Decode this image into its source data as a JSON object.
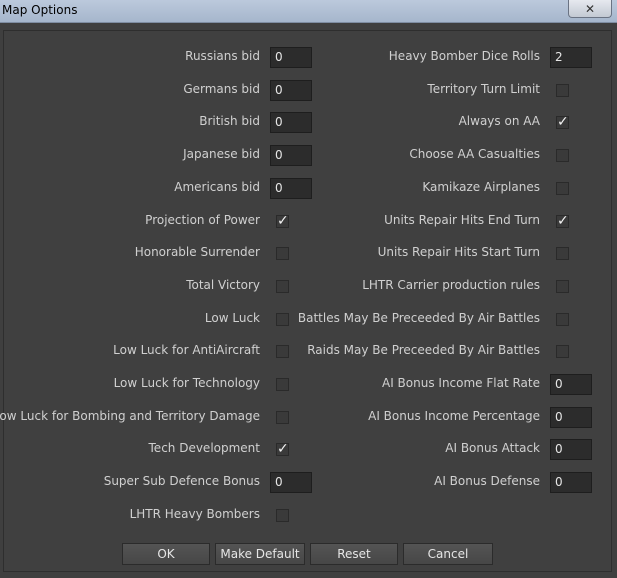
{
  "window": {
    "title": "Map Options",
    "close_glyph": "✕"
  },
  "left": [
    {
      "label": "Russians bid",
      "type": "number",
      "value": "0"
    },
    {
      "label": "Germans bid",
      "type": "number",
      "value": "0"
    },
    {
      "label": "British bid",
      "type": "number",
      "value": "0"
    },
    {
      "label": "Japanese bid",
      "type": "number",
      "value": "0"
    },
    {
      "label": "Americans bid",
      "type": "number",
      "value": "0"
    },
    {
      "label": "Projection of Power",
      "type": "check",
      "checked": true
    },
    {
      "label": "Honorable Surrender",
      "type": "check",
      "checked": false
    },
    {
      "label": "Total Victory",
      "type": "check",
      "checked": false
    },
    {
      "label": "Low Luck",
      "type": "check",
      "checked": false
    },
    {
      "label": "Low Luck for AntiAircraft",
      "type": "check",
      "checked": false
    },
    {
      "label": "Low Luck for Technology",
      "type": "check",
      "checked": false
    },
    {
      "label": "Low Luck for Bombing and Territory Damage",
      "type": "check",
      "checked": false
    },
    {
      "label": "Tech Development",
      "type": "check",
      "checked": true
    },
    {
      "label": "Super Sub Defence Bonus",
      "type": "number",
      "value": "0"
    },
    {
      "label": "LHTR Heavy Bombers",
      "type": "check",
      "checked": false
    }
  ],
  "right": [
    {
      "label": "Heavy Bomber Dice Rolls",
      "type": "number",
      "value": "2"
    },
    {
      "label": "Territory Turn Limit",
      "type": "check",
      "checked": false
    },
    {
      "label": "Always on AA",
      "type": "check",
      "checked": true
    },
    {
      "label": "Choose AA Casualties",
      "type": "check",
      "checked": false
    },
    {
      "label": "Kamikaze Airplanes",
      "type": "check",
      "checked": false
    },
    {
      "label": "Units Repair Hits End Turn",
      "type": "check",
      "checked": true
    },
    {
      "label": "Units Repair Hits Start Turn",
      "type": "check",
      "checked": false
    },
    {
      "label": "LHTR Carrier production rules",
      "type": "check",
      "checked": false
    },
    {
      "label": "Battles May Be Preceeded By Air Battles",
      "type": "check",
      "checked": false
    },
    {
      "label": "Raids May Be Preceeded By Air Battles",
      "type": "check",
      "checked": false
    },
    {
      "label": "AI Bonus Income Flat Rate",
      "type": "number",
      "value": "0"
    },
    {
      "label": "AI Bonus Income Percentage",
      "type": "number",
      "value": "0"
    },
    {
      "label": "AI Bonus Attack",
      "type": "number",
      "value": "0"
    },
    {
      "label": "AI Bonus Defense",
      "type": "number",
      "value": "0"
    }
  ],
  "buttons": {
    "ok": "OK",
    "make_default": "Make Default",
    "reset": "Reset",
    "cancel": "Cancel"
  },
  "checkmark_glyph": "✓",
  "colors": {
    "background": "#404040",
    "titlebar": "#b2c1d6",
    "text": "#d0d0d0"
  }
}
